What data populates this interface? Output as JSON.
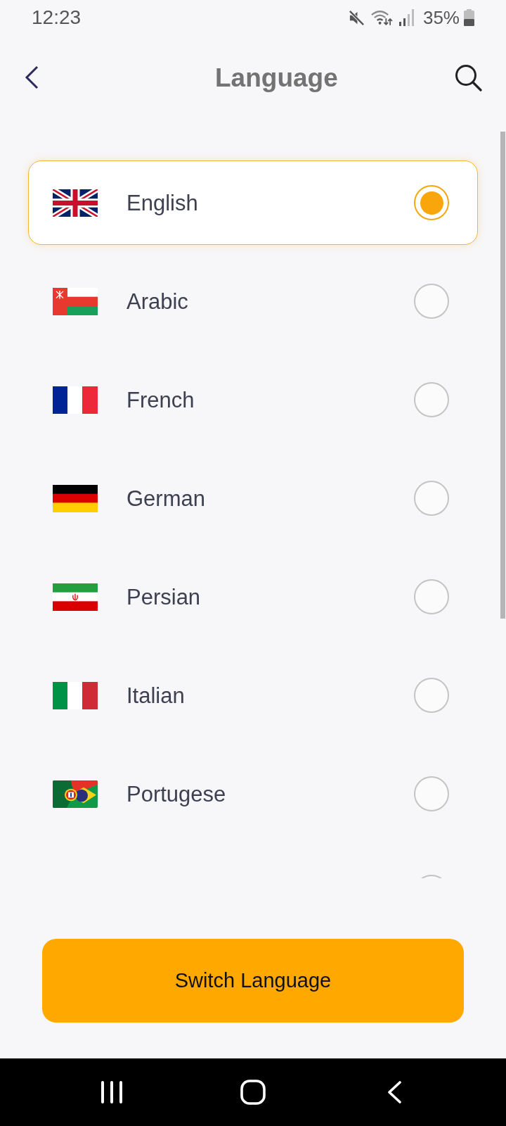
{
  "status_bar": {
    "time": "12:23",
    "battery": "35%"
  },
  "header": {
    "title": "Language"
  },
  "languages": [
    {
      "label": "English",
      "selected": true
    },
    {
      "label": "Arabic",
      "selected": false
    },
    {
      "label": "French",
      "selected": false
    },
    {
      "label": "German",
      "selected": false
    },
    {
      "label": "Persian",
      "selected": false
    },
    {
      "label": "Italian",
      "selected": false
    },
    {
      "label": "Portugese",
      "selected": false
    },
    {
      "selected": false
    }
  ],
  "primary_button": {
    "label": "Switch Language"
  }
}
